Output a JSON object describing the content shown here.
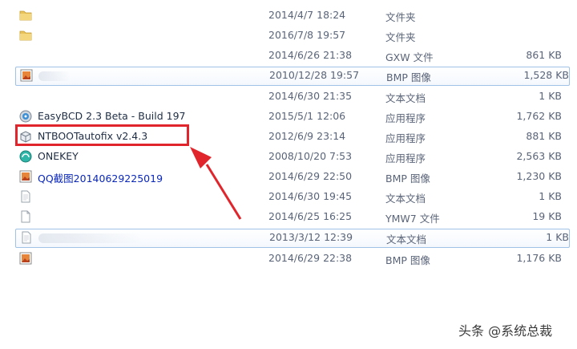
{
  "files": [
    {
      "name": "",
      "date": "2014/4/7 18:24",
      "type": "文件夹",
      "size": "",
      "icon": "folder-icon"
    },
    {
      "name": "",
      "date": "2016/7/8 19:57",
      "type": "文件夹",
      "size": "",
      "icon": "folder-icon"
    },
    {
      "name": "",
      "date": "2014/6/26 21:38",
      "type": "GXW 文件",
      "size": "861 KB",
      "icon": "none"
    },
    {
      "name": "",
      "date": "2010/12/28 19:57",
      "type": "BMP 图像",
      "size": "1,528 KB",
      "icon": "bmp-image-icon"
    },
    {
      "name": "",
      "date": "2014/6/30 21:35",
      "type": "文本文档",
      "size": "1 KB",
      "icon": "none"
    },
    {
      "name": "EasyBCD 2.3 Beta - Build 197",
      "date": "2015/5/1 12:06",
      "type": "应用程序",
      "size": "1,762 KB",
      "icon": "easybcd-app-icon"
    },
    {
      "name": "NTBOOTautofix v2.4.3",
      "date": "2012/6/9 23:14",
      "type": "应用程序",
      "size": "881 KB",
      "icon": "ntboot-app-icon"
    },
    {
      "name": "ONEKEY",
      "date": "2008/10/20 7:53",
      "type": "应用程序",
      "size": "2,563 KB",
      "icon": "onekey-app-icon"
    },
    {
      "name": "QQ截图20140629225019",
      "date": "2014/6/29 22:50",
      "type": "BMP 图像",
      "size": "1,230 KB",
      "icon": "bmp-image-icon"
    },
    {
      "name": "",
      "date": "2014/6/30 19:45",
      "type": "文本文档",
      "size": "1 KB",
      "icon": "text-file-icon"
    },
    {
      "name": "",
      "date": "2014/6/25 16:25",
      "type": "YMW7 文件",
      "size": "19 KB",
      "icon": "blank-file-icon"
    },
    {
      "name": "",
      "date": "2013/3/12 12:39",
      "type": "文本文档",
      "size": "1 KB",
      "icon": "text-file-icon"
    },
    {
      "name": "",
      "date": "2014/6/29 22:38",
      "type": "BMP 图像",
      "size": "1,176 KB",
      "icon": "bmp-image-icon"
    }
  ],
  "watermark": "头条 @系统总裁",
  "colors": {
    "highlight": "#e0262c",
    "selection_border": "#9fc2e6",
    "link_text": "#0b28b8"
  }
}
